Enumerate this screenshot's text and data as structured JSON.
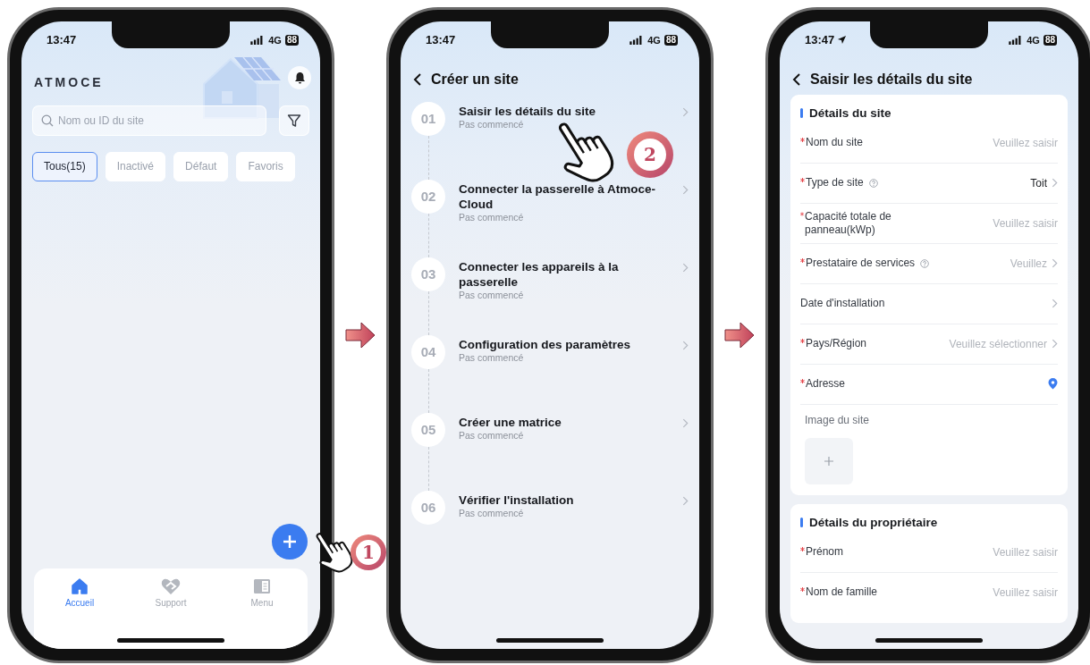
{
  "home": {
    "status_bar": {
      "time": "13:47",
      "network": "4G",
      "battery": "88"
    },
    "brand": "ATMOCE",
    "search": {
      "placeholder": "Nom ou ID du site"
    },
    "filters": [
      {
        "label": "Tous(15)",
        "selected": true
      },
      {
        "label": "Inactivé",
        "selected": false
      },
      {
        "label": "Défaut",
        "selected": false
      },
      {
        "label": "Favoris",
        "selected": false
      }
    ],
    "nav": [
      {
        "label": "Accueil",
        "selected": true
      },
      {
        "label": "Support",
        "selected": false
      },
      {
        "label": "Menu",
        "selected": false
      }
    ]
  },
  "create_site": {
    "status_bar": {
      "time": "13:47",
      "network": "4G",
      "battery": "88"
    },
    "title": "Créer un site",
    "steps": [
      {
        "number": "01",
        "title": "Saisir les détails du site",
        "status": "Pas commencé"
      },
      {
        "number": "02",
        "title": "Connecter la passerelle à Atmoce-Cloud",
        "status": "Pas commencé"
      },
      {
        "number": "03",
        "title": "Connecter les appareils à la passerelle",
        "status": "Pas commencé"
      },
      {
        "number": "04",
        "title": "Configuration des paramètres",
        "status": "Pas commencé"
      },
      {
        "number": "05",
        "title": "Créer une matrice",
        "status": "Pas commencé"
      },
      {
        "number": "06",
        "title": "Vérifier l'installation",
        "status": "Pas commencé"
      }
    ]
  },
  "site_details": {
    "status_bar": {
      "time": "13:47",
      "location": true,
      "network": "4G",
      "battery": "88"
    },
    "title": "Saisir les détails du site",
    "sections": [
      {
        "title": "Détails du site",
        "fields": [
          {
            "kind": "input",
            "label": "Nom du site",
            "required": true,
            "placeholder": "Veuillez saisir"
          },
          {
            "kind": "select",
            "label": "Type de site",
            "required": true,
            "help": true,
            "value": "Toit"
          },
          {
            "kind": "input",
            "label": "Capacité totale de panneau(kWp)",
            "required": true,
            "placeholder": "Veuillez saisir"
          },
          {
            "kind": "select",
            "label": "Prestataire de services",
            "required": true,
            "help": true,
            "placeholder": "Veuillez"
          },
          {
            "kind": "select",
            "label": "Date d'installation"
          },
          {
            "kind": "select",
            "label": "Pays/Région",
            "required": true,
            "placeholder": "Veuillez sélectionner"
          },
          {
            "kind": "location",
            "label": "Adresse",
            "required": true
          },
          {
            "kind": "image",
            "label": "Image du site"
          }
        ]
      },
      {
        "title": "Détails du propriétaire",
        "fields": [
          {
            "kind": "input",
            "label": "Prénom",
            "required": true,
            "placeholder": "Veuillez saisir"
          },
          {
            "kind": "input",
            "label": "Nom de famille",
            "required": true,
            "placeholder": "Veuillez saisir"
          }
        ]
      }
    ]
  },
  "callouts": [
    {
      "label": "1"
    },
    {
      "label": "2"
    }
  ]
}
